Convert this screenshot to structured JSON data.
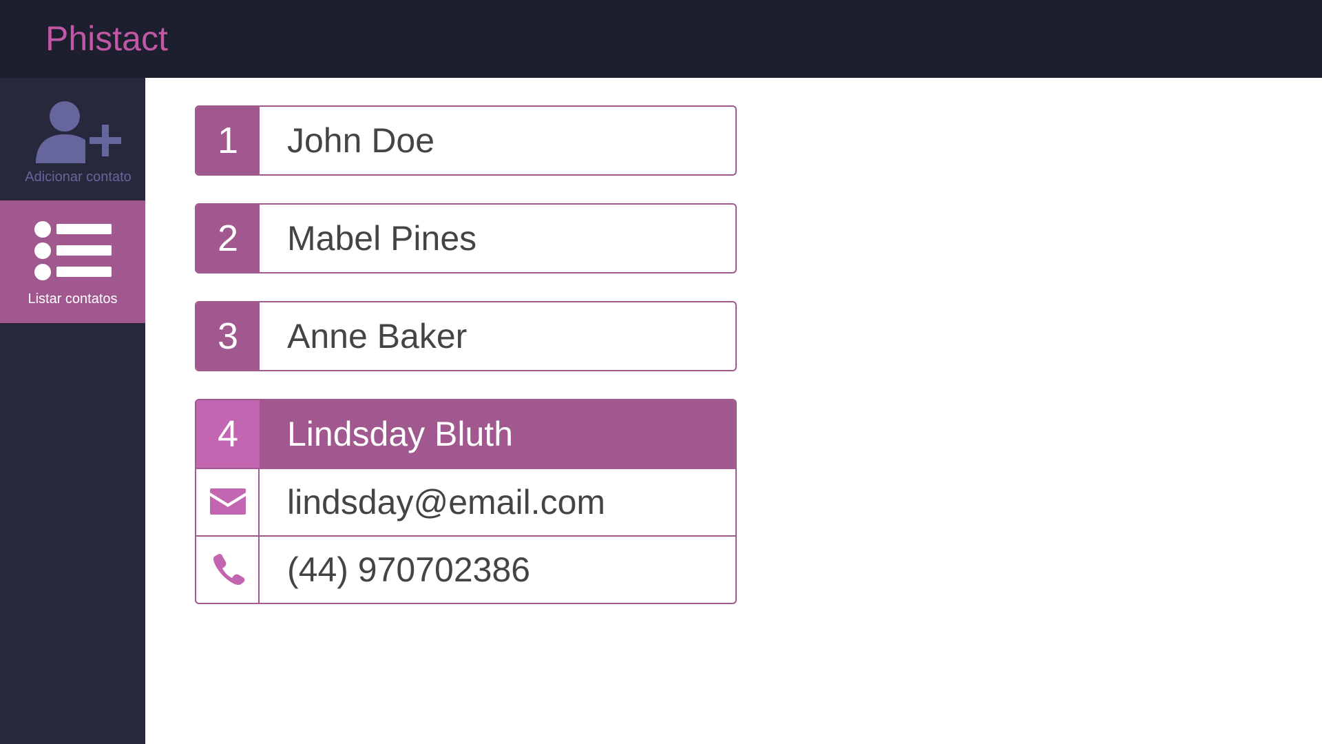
{
  "app": {
    "brand": "Phistact",
    "colors": {
      "accent": "#a0588e",
      "accent_light": "#c266b1",
      "brand": "#c058a6",
      "topbar_bg": "#1e1f2e",
      "sidebar_bg": "#27283c"
    }
  },
  "sidebar": {
    "items": [
      {
        "label": "Adicionar contato",
        "icon": "add-user-icon",
        "active": false
      },
      {
        "label": "Listar contatos",
        "icon": "list-icon",
        "active": true
      }
    ]
  },
  "contacts": [
    {
      "number": "1",
      "name": "John Doe",
      "expanded": false
    },
    {
      "number": "2",
      "name": "Mabel Pines",
      "expanded": false
    },
    {
      "number": "3",
      "name": "Anne Baker",
      "expanded": false
    },
    {
      "number": "4",
      "name": "Lindsday Bluth",
      "expanded": true,
      "email": "lindsday@email.com",
      "email_icon": "envelope-icon",
      "phone": "(44) 970702386",
      "phone_icon": "phone-icon"
    }
  ]
}
